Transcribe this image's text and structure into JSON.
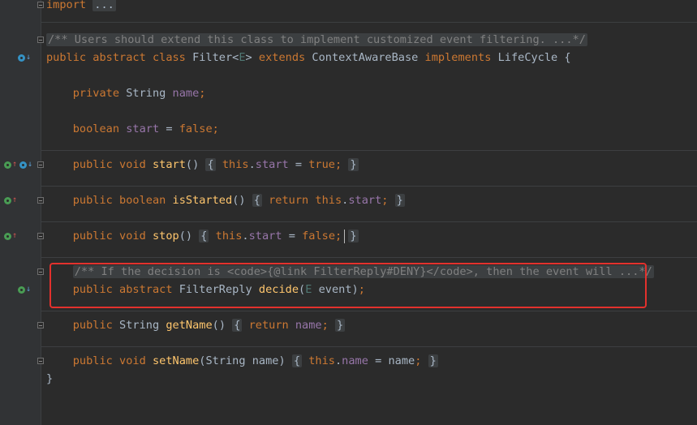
{
  "editor": {
    "code_lines": [
      {
        "tokens": [
          {
            "cls": "kw",
            "t": "import"
          },
          {
            "cls": "",
            "t": " "
          },
          {
            "cls": "fe",
            "t": "..."
          }
        ]
      },
      {
        "tokens": [
          {
            "cls": "fe cm",
            "t": "/** Users should extend this class to implement customized event filtering. ...*/"
          }
        ]
      },
      {
        "tokens": [
          {
            "cls": "kw",
            "t": "public abstract class "
          },
          {
            "cls": "",
            "t": "Filter<"
          },
          {
            "cls": "tp",
            "t": "E"
          },
          {
            "cls": "",
            "t": "> "
          },
          {
            "cls": "kw",
            "t": "extends "
          },
          {
            "cls": "",
            "t": "ContextAwareBase "
          },
          {
            "cls": "kw",
            "t": "implements "
          },
          {
            "cls": "",
            "t": "LifeCycle {"
          }
        ]
      },
      {
        "tokens": [
          {
            "cls": "",
            "t": "    "
          },
          {
            "cls": "kw",
            "t": "private "
          },
          {
            "cls": "",
            "t": "String "
          },
          {
            "cls": "fld",
            "t": "name"
          },
          {
            "cls": "kw",
            "t": ";"
          }
        ]
      },
      {
        "tokens": [
          {
            "cls": "",
            "t": "    "
          },
          {
            "cls": "kw",
            "t": "boolean "
          },
          {
            "cls": "fld",
            "t": "start "
          },
          {
            "cls": "",
            "t": "= "
          },
          {
            "cls": "kw",
            "t": "false;"
          }
        ]
      },
      {
        "tokens": [
          {
            "cls": "",
            "t": "    "
          },
          {
            "cls": "kw",
            "t": "public void "
          },
          {
            "cls": "fn",
            "t": "start"
          },
          {
            "cls": "",
            "t": "() "
          },
          {
            "cls": "fe",
            "t": "{"
          },
          {
            "cls": "",
            "t": " "
          },
          {
            "cls": "kw",
            "t": "this"
          },
          {
            "cls": "",
            "t": "."
          },
          {
            "cls": "fld",
            "t": "start "
          },
          {
            "cls": "",
            "t": "= "
          },
          {
            "cls": "kw",
            "t": "true;"
          },
          {
            "cls": "",
            "t": " "
          },
          {
            "cls": "fe",
            "t": "}"
          }
        ]
      },
      {
        "tokens": [
          {
            "cls": "",
            "t": "    "
          },
          {
            "cls": "kw",
            "t": "public boolean "
          },
          {
            "cls": "fn",
            "t": "isStarted"
          },
          {
            "cls": "",
            "t": "() "
          },
          {
            "cls": "fe",
            "t": "{"
          },
          {
            "cls": "",
            "t": " "
          },
          {
            "cls": "kw",
            "t": "return this"
          },
          {
            "cls": "",
            "t": "."
          },
          {
            "cls": "fld",
            "t": "start"
          },
          {
            "cls": "kw",
            "t": ";"
          },
          {
            "cls": "",
            "t": " "
          },
          {
            "cls": "fe",
            "t": "}"
          }
        ]
      },
      {
        "tokens": [
          {
            "cls": "",
            "t": "    "
          },
          {
            "cls": "kw",
            "t": "public void "
          },
          {
            "cls": "fn",
            "t": "stop"
          },
          {
            "cls": "",
            "t": "() "
          },
          {
            "cls": "fe",
            "t": "{"
          },
          {
            "cls": "",
            "t": " "
          },
          {
            "cls": "kw",
            "t": "this"
          },
          {
            "cls": "",
            "t": "."
          },
          {
            "cls": "fld",
            "t": "start "
          },
          {
            "cls": "",
            "t": "= "
          },
          {
            "cls": "kw",
            "t": "false;"
          },
          {
            "cls": "",
            "t": " "
          },
          {
            "cls": "fe",
            "t": "}"
          }
        ]
      },
      {
        "tokens": [
          {
            "cls": "",
            "t": "    "
          },
          {
            "cls": "fe cm",
            "t": "/** If the decision is <code>{@link FilterReply#DENY}</code>, then the event will ...*/"
          }
        ]
      },
      {
        "tokens": [
          {
            "cls": "",
            "t": "    "
          },
          {
            "cls": "kw",
            "t": "public abstract "
          },
          {
            "cls": "",
            "t": "FilterReply "
          },
          {
            "cls": "fn",
            "t": "decide"
          },
          {
            "cls": "",
            "t": "("
          },
          {
            "cls": "tp",
            "t": "E"
          },
          {
            "cls": "",
            "t": " event)"
          },
          {
            "cls": "kw",
            "t": ";"
          }
        ]
      },
      {
        "tokens": [
          {
            "cls": "",
            "t": "    "
          },
          {
            "cls": "kw",
            "t": "public "
          },
          {
            "cls": "",
            "t": "String "
          },
          {
            "cls": "fn",
            "t": "getName"
          },
          {
            "cls": "",
            "t": "() "
          },
          {
            "cls": "fe",
            "t": "{"
          },
          {
            "cls": "",
            "t": " "
          },
          {
            "cls": "kw",
            "t": "return "
          },
          {
            "cls": "fld",
            "t": "name"
          },
          {
            "cls": "kw",
            "t": ";"
          },
          {
            "cls": "",
            "t": " "
          },
          {
            "cls": "fe",
            "t": "}"
          }
        ]
      },
      {
        "tokens": [
          {
            "cls": "",
            "t": "    "
          },
          {
            "cls": "kw",
            "t": "public void "
          },
          {
            "cls": "fn",
            "t": "setName"
          },
          {
            "cls": "",
            "t": "(String name) "
          },
          {
            "cls": "fe",
            "t": "{"
          },
          {
            "cls": "",
            "t": " "
          },
          {
            "cls": "kw",
            "t": "this"
          },
          {
            "cls": "",
            "t": "."
          },
          {
            "cls": "fld",
            "t": "name "
          },
          {
            "cls": "",
            "t": "= name"
          },
          {
            "cls": "kw",
            "t": ";"
          },
          {
            "cls": "",
            "t": " "
          },
          {
            "cls": "fe",
            "t": "}"
          }
        ]
      },
      {
        "tokens": [
          {
            "cls": "",
            "t": "}"
          }
        ]
      }
    ],
    "gutter_icons": [
      {
        "name": "implemented-down-icon",
        "kind": "blue-down"
      },
      {
        "name": "overrides-implemented-icon",
        "kind": "green-up-blue-down"
      },
      {
        "name": "overrides-up-icon",
        "kind": "green-up"
      },
      {
        "name": "overrides-up-icon",
        "kind": "green-up"
      },
      {
        "name": "implemented-down-icon",
        "kind": "green-down"
      }
    ],
    "highlight_color": "#e3312d",
    "theme": {
      "background": "#2b2b2b",
      "gutter": "#313335",
      "keyword": "#cc7832",
      "field": "#9876aa",
      "method": "#ffc66d",
      "comment": "#808080"
    }
  }
}
